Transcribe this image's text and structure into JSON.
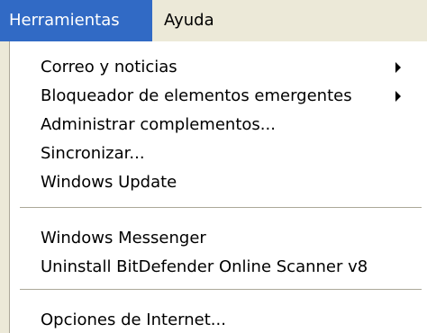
{
  "menubar": {
    "items": [
      {
        "label": "Herramientas",
        "active": true
      },
      {
        "label": "Ayuda",
        "active": false
      }
    ]
  },
  "menu": {
    "groups": [
      [
        {
          "label": "Correo y noticias",
          "submenu": true
        },
        {
          "label": "Bloqueador de elementos emergentes",
          "submenu": true
        },
        {
          "label": "Administrar complementos...",
          "submenu": false
        },
        {
          "label": "Sincronizar...",
          "submenu": false
        },
        {
          "label": "Windows Update",
          "submenu": false
        }
      ],
      [
        {
          "label": "Windows Messenger",
          "submenu": false
        },
        {
          "label": "Uninstall BitDefender Online Scanner v8",
          "submenu": false
        }
      ],
      [
        {
          "label": "Opciones de Internet...",
          "submenu": false
        }
      ]
    ]
  },
  "colors": {
    "highlight": "#316ac5",
    "menubar_bg": "#ece9d8",
    "menu_bg": "#ffffff"
  }
}
